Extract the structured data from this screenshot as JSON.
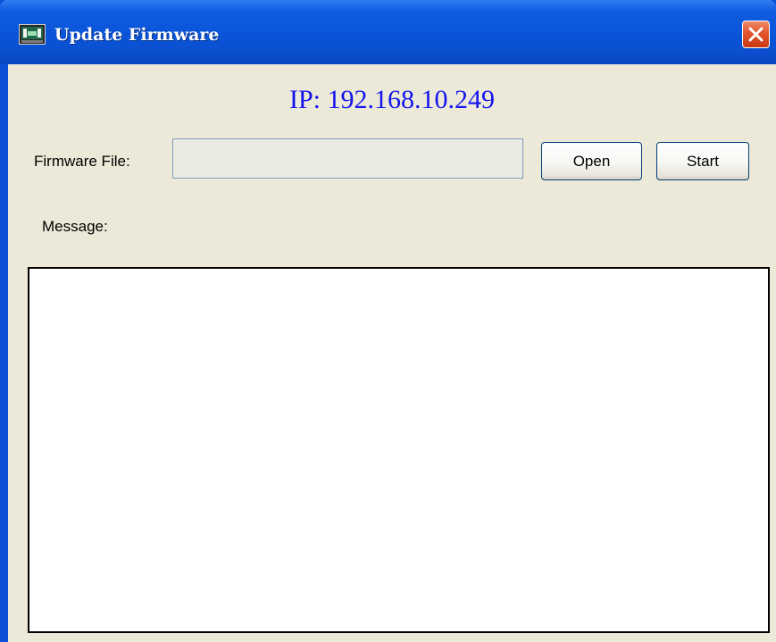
{
  "window": {
    "title": "Update Firmware",
    "app_icon": "firmware-app-icon",
    "close_icon": "close-icon"
  },
  "main": {
    "ip_text": "IP: 192.168.10.249",
    "firmware_file": {
      "label": "Firmware File:",
      "value": "",
      "placeholder": ""
    },
    "open_button": "Open",
    "start_button": "Start",
    "message_label": "Message:",
    "message_text": ""
  },
  "colors": {
    "titlebar": "#0a54d8",
    "client_bg": "#ece9d8",
    "ip_text": "#1414ee",
    "close_button": "#e2552e"
  }
}
